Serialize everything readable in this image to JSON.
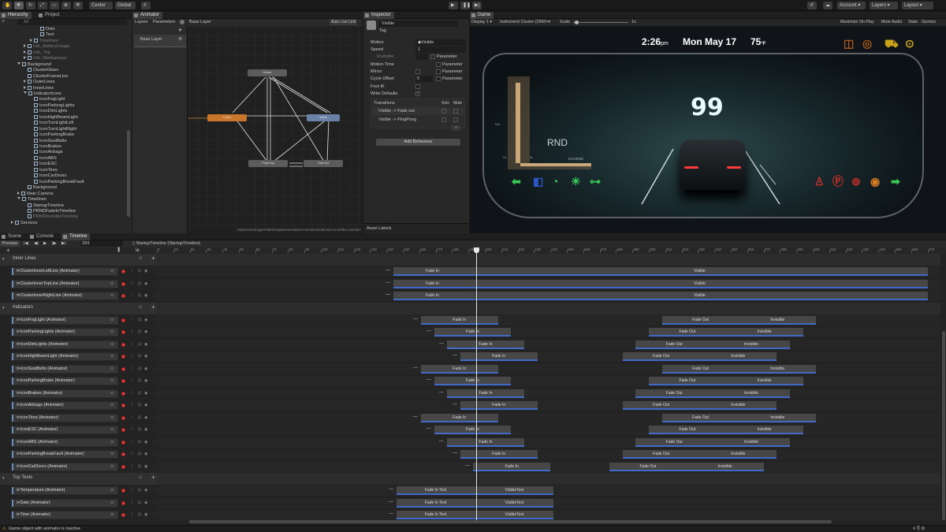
{
  "toolbar": {
    "center": "Center",
    "global": "Global",
    "account": "Account",
    "layers": "Layers",
    "layout": "Layout"
  },
  "hierarchy": {
    "tabs": [
      "Hierarchy",
      "Project"
    ],
    "search_placeholder": "All",
    "items": [
      {
        "label": "Dots",
        "indent": 7,
        "dim": false,
        "exp": ""
      },
      {
        "label": "Text",
        "indent": 7,
        "dim": false,
        "exp": ""
      },
      {
        "label": "Timelines",
        "indent": 6,
        "dim": true,
        "exp": "r"
      },
      {
        "label": "Info_BatteryUsage",
        "indent": 5,
        "dim": true,
        "exp": "r"
      },
      {
        "label": "Info_Trip",
        "indent": 5,
        "dim": true,
        "exp": "r"
      },
      {
        "label": "Info_Mediaplayer",
        "indent": 5,
        "dim": true,
        "exp": "r"
      },
      {
        "label": "Background",
        "indent": 4,
        "dim": false,
        "exp": "d"
      },
      {
        "label": "ClusterGlass",
        "indent": 5,
        "dim": false,
        "exp": ""
      },
      {
        "label": "ClusterFrameLine",
        "indent": 5,
        "dim": false,
        "exp": ""
      },
      {
        "label": "OuterLines",
        "indent": 5,
        "dim": false,
        "exp": "r"
      },
      {
        "label": "InnerLines",
        "indent": 5,
        "dim": false,
        "exp": "r"
      },
      {
        "label": "IndicatorIcons",
        "indent": 5,
        "dim": false,
        "exp": "d"
      },
      {
        "label": "IconFogLight",
        "indent": 6,
        "dim": false,
        "exp": ""
      },
      {
        "label": "IconParkingLights",
        "indent": 6,
        "dim": false,
        "exp": ""
      },
      {
        "label": "IconDimLights",
        "indent": 6,
        "dim": false,
        "exp": ""
      },
      {
        "label": "IconHighBeamLight",
        "indent": 6,
        "dim": false,
        "exp": ""
      },
      {
        "label": "IconTurnLightLeft",
        "indent": 6,
        "dim": false,
        "exp": ""
      },
      {
        "label": "IconTurnLightRight",
        "indent": 6,
        "dim": false,
        "exp": ""
      },
      {
        "label": "IconParkingBrake",
        "indent": 6,
        "dim": false,
        "exp": ""
      },
      {
        "label": "IconSeatBelts",
        "indent": 6,
        "dim": false,
        "exp": ""
      },
      {
        "label": "IconBrakes",
        "indent": 6,
        "dim": false,
        "exp": ""
      },
      {
        "label": "IconAirbags",
        "indent": 6,
        "dim": false,
        "exp": ""
      },
      {
        "label": "IconABS",
        "indent": 6,
        "dim": false,
        "exp": ""
      },
      {
        "label": "IconESC",
        "indent": 6,
        "dim": false,
        "exp": ""
      },
      {
        "label": "IconTires",
        "indent": 6,
        "dim": false,
        "exp": ""
      },
      {
        "label": "IconCarDoors",
        "indent": 6,
        "dim": false,
        "exp": ""
      },
      {
        "label": "IconParkingBreakFault",
        "indent": 6,
        "dim": false,
        "exp": ""
      },
      {
        "label": "Background",
        "indent": 5,
        "dim": false,
        "exp": ""
      },
      {
        "label": "Main Camera",
        "indent": 4,
        "dim": false,
        "exp": "r"
      },
      {
        "label": "Timelines",
        "indent": 4,
        "dim": false,
        "exp": "d"
      },
      {
        "label": "StartupTimeline",
        "indent": 5,
        "dim": false,
        "exp": ""
      },
      {
        "label": "PRNDFadeInTimeline",
        "indent": 5,
        "dim": false,
        "exp": ""
      },
      {
        "label": "PRNDInvisibleTimeline",
        "indent": 5,
        "dim": true,
        "exp": ""
      },
      {
        "label": "Services",
        "indent": 3,
        "dim": false,
        "exp": "r"
      }
    ]
  },
  "animator": {
    "tab": "Animator",
    "layers_tab": "Layers",
    "parameters_tab": "Parameters",
    "breadcrumb": "Base Layer",
    "auto_live": "Auto Live Link",
    "base_layer": "Base Layer",
    "footer": "UnityTechnologies/HMITemplate/AnimationControllers/IndicatorController.controller",
    "nodes": {
      "fadein": "FadeIn",
      "visible": "Visible",
      "hidden": "Hidden",
      "pingpong": "PingPong",
      "fadeout": "Fade Out"
    }
  },
  "inspector": {
    "tab": "Inspector",
    "name": "Visible",
    "tag": "Tag",
    "motion_label": "Motion",
    "motion_value": "Visible",
    "speed_label": "Speed",
    "speed_value": "1",
    "multiplier_label": "Multiplier",
    "parameter": "Parameter",
    "motion_time_label": "Motion Time",
    "mirror_label": "Mirror",
    "cycle_offset_label": "Cycle Offset",
    "cycle_offset_value": "0",
    "foot_ik_label": "Foot IK",
    "write_defaults_label": "Write Defaults",
    "transitions_label": "Transitions",
    "solo": "Solo",
    "mute": "Mute",
    "transitions": [
      "Visible -> Fade out",
      "Visible -> PingPong"
    ],
    "add_behaviour": "Add Behaviour",
    "asset_labels": "Asset Labels"
  },
  "game": {
    "tab": "Game",
    "display": "Display 1",
    "resolution": "Instrument Cluster (2560×",
    "scale_label": "Scale",
    "scale_value": "1x",
    "maximize": "Maximize On Play",
    "mute": "Mute Audio",
    "stats": "Stats",
    "gizmos": "Gizmos",
    "time": "2:26",
    "ampm": "pm",
    "date": "Mon May 17",
    "temp": "75",
    "temp_unit": "°F",
    "speed": "99",
    "gear": "RND",
    "charge": "CHARGE",
    "gauge_60": "60s",
    "gauge_0": "0s",
    "gauge_0b": "0s"
  },
  "timeline": {
    "tabs": [
      "Scene",
      "Console",
      "Timeline"
    ],
    "preview": "Preview",
    "frame": "204",
    "asset": "StartupTimeline (StartupTimeline)",
    "ruler": [
      "0",
      "10",
      "20",
      "30",
      "40",
      "50",
      "60",
      "70",
      "80",
      "90",
      "100",
      "110",
      "120",
      "130",
      "140",
      "150",
      "160",
      "170",
      "180",
      "190",
      "200",
      "210",
      "220",
      "230",
      "240",
      "250",
      "260",
      "270",
      "280",
      "290",
      "300",
      "310",
      "320",
      "330",
      "340",
      "350",
      "360",
      "370",
      "380",
      "390",
      "400",
      "410",
      "420",
      "430",
      "440",
      "450",
      "460",
      "470"
    ],
    "groups": [
      {
        "name": "Inner Lines",
        "tracks": [
          {
            "name": "ClusterInnerLeftLine (Animator)",
            "clips": [
              {
                "l": "Fade In",
                "s": 144,
                "e": 192
              },
              {
                "l": "Visible",
                "s": 192,
                "e": 470
              }
            ]
          },
          {
            "name": "ClusterInnerTopLine (Animator)",
            "clips": [
              {
                "l": "Fade In",
                "s": 144,
                "e": 192
              },
              {
                "l": "Visible",
                "s": 192,
                "e": 470
              }
            ]
          },
          {
            "name": "ClusterInnerRightLine (Animator)",
            "clips": [
              {
                "l": "Fade In",
                "s": 144,
                "e": 192
              },
              {
                "l": "Visible",
                "s": 192,
                "e": 470
              }
            ]
          }
        ]
      },
      {
        "name": "Indicators",
        "tracks": [
          {
            "name": "IconFogLight (Animator)",
            "clips": [
              {
                "l": "Fade In",
                "s": 161,
                "e": 208
              },
              {
                "l": "Fade Out",
                "s": 308,
                "e": 355
              },
              {
                "l": "Invisible",
                "s": 355,
                "e": 402
              }
            ]
          },
          {
            "name": "IconParkingLights (Animator)",
            "clips": [
              {
                "l": "Fade In",
                "s": 169,
                "e": 216
              },
              {
                "l": "Fade Out",
                "s": 300,
                "e": 347
              },
              {
                "l": "Invisible",
                "s": 347,
                "e": 394
              }
            ]
          },
          {
            "name": "IconDimLights (Animator)",
            "clips": [
              {
                "l": "Fade In",
                "s": 177,
                "e": 224
              },
              {
                "l": "Fade Out",
                "s": 292,
                "e": 339
              },
              {
                "l": "Invisible",
                "s": 339,
                "e": 386
              }
            ]
          },
          {
            "name": "IconHighBeamLight (Animator)",
            "clips": [
              {
                "l": "Fade In",
                "s": 185,
                "e": 232
              },
              {
                "l": "Fade Out",
                "s": 284,
                "e": 331
              },
              {
                "l": "Invisible",
                "s": 331,
                "e": 378
              }
            ]
          },
          {
            "name": "IconSeatBelts (Animator)",
            "clips": [
              {
                "l": "Fade In",
                "s": 161,
                "e": 208
              },
              {
                "l": "Fade Out",
                "s": 308,
                "e": 355
              },
              {
                "l": "Invisible",
                "s": 355,
                "e": 402
              }
            ]
          },
          {
            "name": "IconParkingBrake (Animator)",
            "clips": [
              {
                "l": "Fade In",
                "s": 169,
                "e": 216
              },
              {
                "l": "Fade Out",
                "s": 300,
                "e": 347
              },
              {
                "l": "Invisible",
                "s": 347,
                "e": 394
              }
            ]
          },
          {
            "name": "IconBrakes (Animator)",
            "clips": [
              {
                "l": "Fade In",
                "s": 177,
                "e": 224
              },
              {
                "l": "Fade Out",
                "s": 292,
                "e": 339
              },
              {
                "l": "Invisible",
                "s": 339,
                "e": 386
              }
            ]
          },
          {
            "name": "IconAirbags (Animator)",
            "clips": [
              {
                "l": "Fade In",
                "s": 185,
                "e": 232
              },
              {
                "l": "Fade Out",
                "s": 284,
                "e": 331
              },
              {
                "l": "Invisible",
                "s": 331,
                "e": 378
              }
            ]
          },
          {
            "name": "IconTires (Animator)",
            "clips": [
              {
                "l": "Fade In",
                "s": 161,
                "e": 208
              },
              {
                "l": "Fade Out",
                "s": 308,
                "e": 355
              },
              {
                "l": "Invisible",
                "s": 355,
                "e": 402
              }
            ]
          },
          {
            "name": "IconESC (Animator)",
            "clips": [
              {
                "l": "Fade In",
                "s": 169,
                "e": 216
              },
              {
                "l": "Fade Out",
                "s": 300,
                "e": 347
              },
              {
                "l": "Invisible",
                "s": 347,
                "e": 394
              }
            ]
          },
          {
            "name": "IconABS (Animator)",
            "clips": [
              {
                "l": "Fade In",
                "s": 177,
                "e": 224
              },
              {
                "l": "Fade Out",
                "s": 292,
                "e": 339
              },
              {
                "l": "Invisible",
                "s": 339,
                "e": 386
              }
            ]
          },
          {
            "name": "IconParkingBreakFault (Animator)",
            "clips": [
              {
                "l": "Fade In",
                "s": 185,
                "e": 232
              },
              {
                "l": "Fade Out",
                "s": 284,
                "e": 331
              },
              {
                "l": "Invisible",
                "s": 331,
                "e": 378
              }
            ]
          },
          {
            "name": "IconCarDoors (Animator)",
            "clips": [
              {
                "l": "Fade In",
                "s": 193,
                "e": 240
              },
              {
                "l": "Fade Out",
                "s": 276,
                "e": 323
              },
              {
                "l": "Invisible",
                "s": 323,
                "e": 370
              }
            ]
          }
        ]
      },
      {
        "name": "Top Texts",
        "tracks": [
          {
            "name": "Temperature (Animator)",
            "clips": [
              {
                "l": "Fade In Text",
                "s": 146,
                "e": 194
              },
              {
                "l": "VisibleText",
                "s": 194,
                "e": 242
              }
            ]
          },
          {
            "name": "Date (Animator)",
            "clips": [
              {
                "l": "Fade In Text",
                "s": 146,
                "e": 194
              },
              {
                "l": "VisibleText",
                "s": 194,
                "e": 242
              }
            ]
          },
          {
            "name": "Time (Animator)",
            "clips": [
              {
                "l": "Fade In Text",
                "s": 146,
                "e": 194
              },
              {
                "l": "VisibleText",
                "s": 194,
                "e": 242
              }
            ]
          }
        ]
      }
    ]
  },
  "status": {
    "message": "Game object with animator is inactive"
  }
}
